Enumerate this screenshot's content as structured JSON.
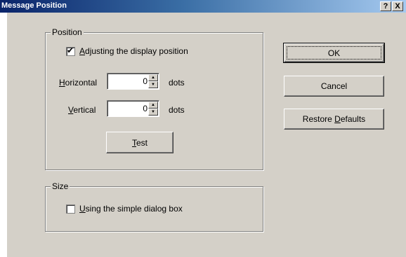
{
  "title": "Message Position",
  "titlebar_buttons": {
    "help": "?",
    "close": "X"
  },
  "position": {
    "legend": "Position",
    "adjust": {
      "pre": "",
      "accel": "A",
      "post": "djusting the display position",
      "checked": true
    },
    "horizontal": {
      "pre": "",
      "accel": "H",
      "post": "orizontal",
      "value": "0",
      "unit": "dots"
    },
    "vertical": {
      "pre": "",
      "accel": "V",
      "post": "ertical",
      "value": "0",
      "unit": "dots"
    },
    "test": {
      "pre": "",
      "accel": "T",
      "post": "est"
    }
  },
  "size": {
    "legend": "Size",
    "simple": {
      "pre": "",
      "accel": "U",
      "post": "sing the simple dialog box",
      "checked": false
    }
  },
  "buttons": {
    "ok": "OK",
    "cancel": "Cancel",
    "restore": {
      "pre": "Restore ",
      "accel": "D",
      "post": "efaults"
    }
  }
}
